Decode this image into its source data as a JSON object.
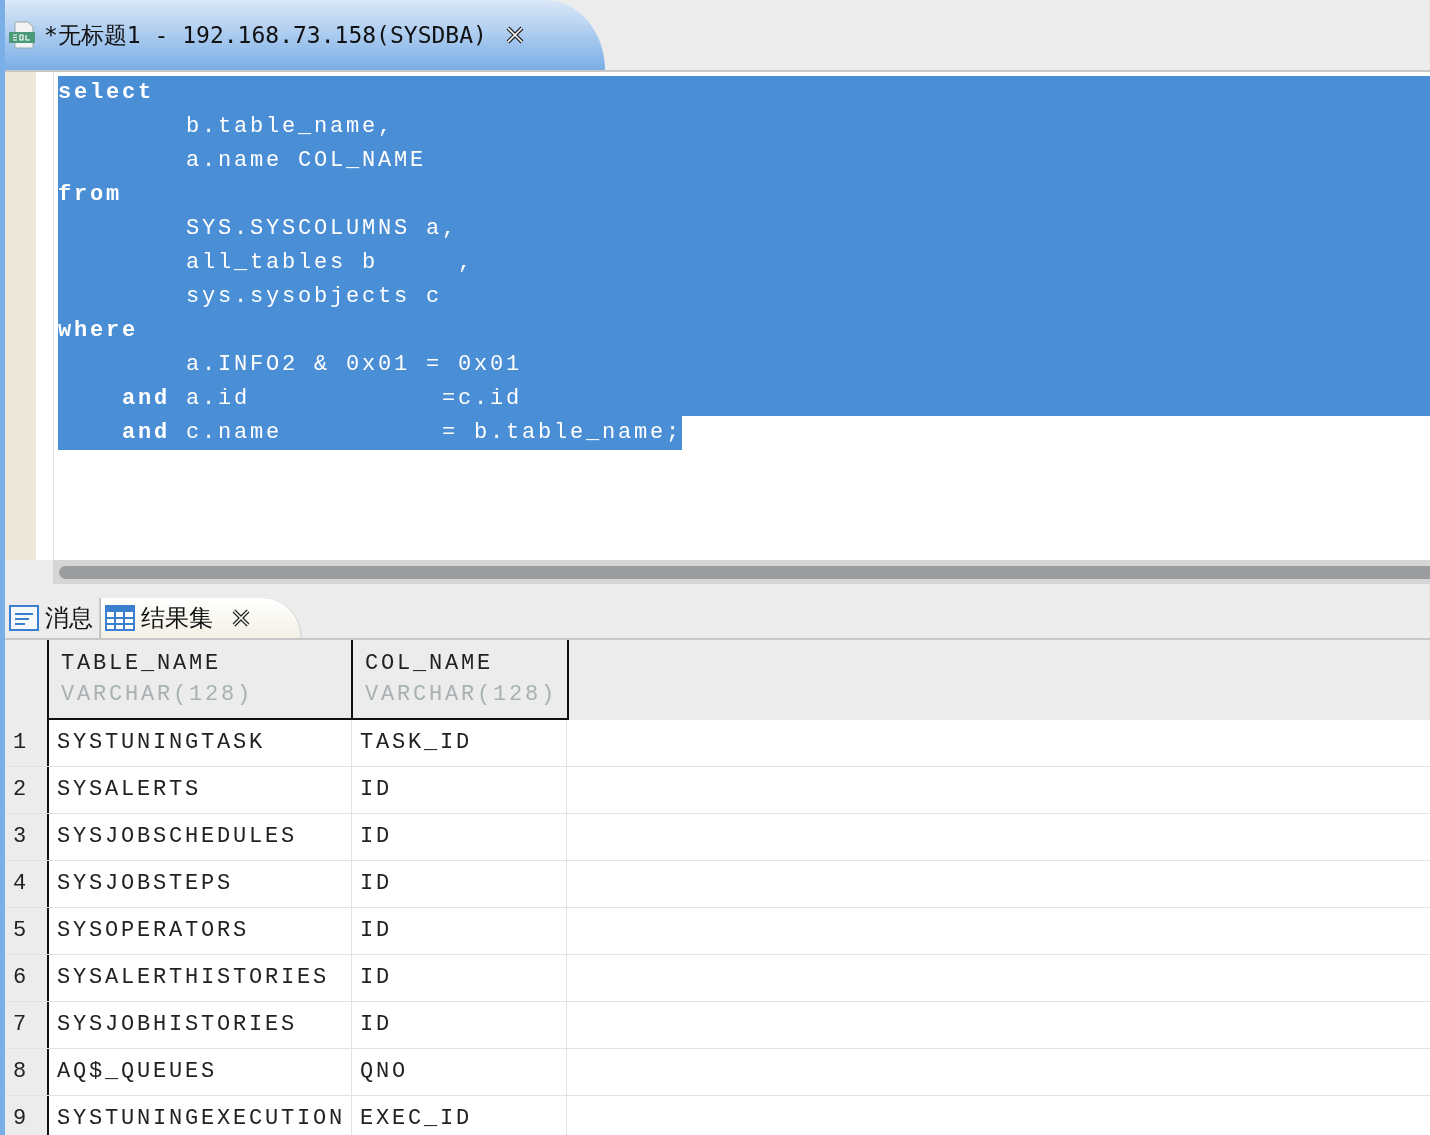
{
  "editor_tab": {
    "title": "*无标题1 - 192.168.73.158(SYSDBA)"
  },
  "editor": {
    "lines": [
      {
        "selected": true,
        "kind": "keyword",
        "text": "select"
      },
      {
        "selected": true,
        "kind": "code",
        "text": "        b.table_name,"
      },
      {
        "selected": true,
        "kind": "code",
        "text": "        a.name COL_NAME"
      },
      {
        "selected": true,
        "kind": "keyword",
        "text": "from"
      },
      {
        "selected": true,
        "kind": "code",
        "text": "        SYS.SYSCOLUMNS a,"
      },
      {
        "selected": true,
        "kind": "code",
        "text": "        all_tables b     ,"
      },
      {
        "selected": true,
        "kind": "code",
        "text": "        sys.sysobjects c"
      },
      {
        "selected": true,
        "kind": "keyword",
        "text": "where"
      },
      {
        "selected": true,
        "kind": "code",
        "text": "        a.INFO2 & 0x01 = 0x01"
      },
      {
        "selected": true,
        "kind": "code",
        "text": "    **and** a.id            =c.id"
      },
      {
        "selected": true,
        "kind": "code",
        "text": "    **and** c.name          = b.table_name;"
      }
    ]
  },
  "result_tabs": [
    {
      "label": "消息",
      "kind": "message",
      "selected": false,
      "closable": false
    },
    {
      "label": "结果集",
      "kind": "grid",
      "selected": true,
      "closable": true
    }
  ],
  "table": {
    "columns": [
      {
        "name": "TABLE_NAME",
        "type": "VARCHAR(128)"
      },
      {
        "name": "COL_NAME",
        "type": "VARCHAR(128)"
      }
    ],
    "rows": [
      {
        "number": "1",
        "cells": [
          "SYSTUNINGTASK",
          "TASK_ID"
        ]
      },
      {
        "number": "2",
        "cells": [
          "SYSALERTS",
          "ID"
        ]
      },
      {
        "number": "3",
        "cells": [
          "SYSJOBSCHEDULES",
          "ID"
        ]
      },
      {
        "number": "4",
        "cells": [
          "SYSJOBSTEPS",
          "ID"
        ]
      },
      {
        "number": "5",
        "cells": [
          "SYSOPERATORS",
          "ID"
        ]
      },
      {
        "number": "6",
        "cells": [
          "SYSALERTHISTORIES",
          "ID"
        ]
      },
      {
        "number": "7",
        "cells": [
          "SYSJOBHISTORIES",
          "ID"
        ]
      },
      {
        "number": "8",
        "cells": [
          "AQ$_QUEUES",
          "QNO"
        ]
      },
      {
        "number": "9",
        "cells": [
          "SYSTUNINGEXECUTION",
          "EXEC_ID"
        ]
      }
    ]
  }
}
